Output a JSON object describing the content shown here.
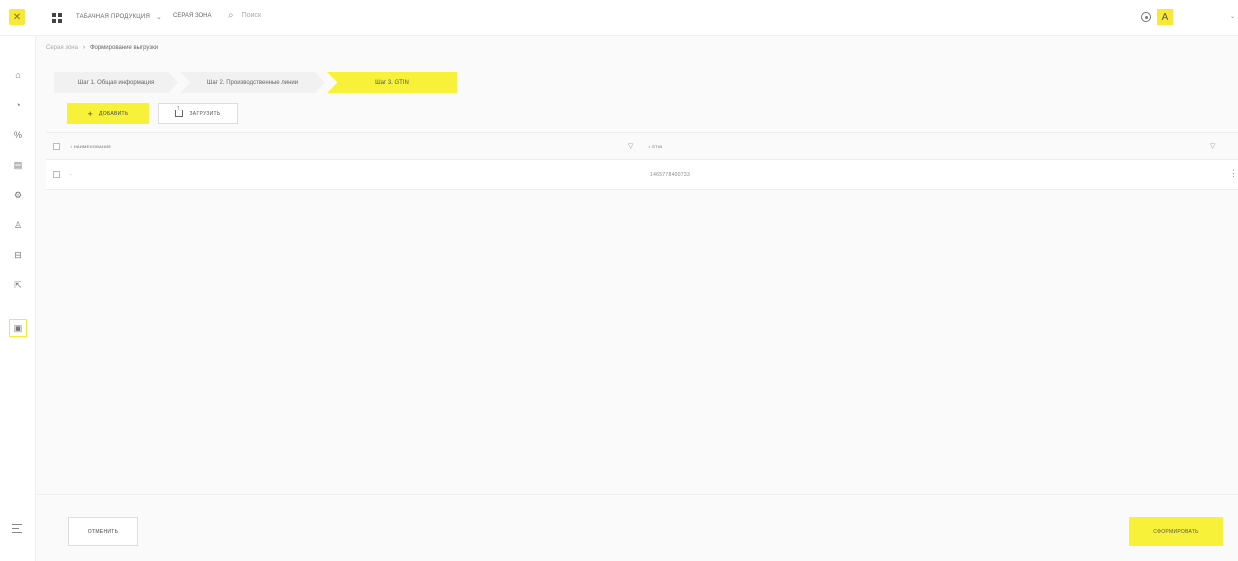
{
  "topbar": {
    "product_label": "ТАБАЧНАЯ ПРОДУКЦИЯ",
    "zone_label": "СЕРАЯ ЗОНА",
    "search_placeholder": "Поиск",
    "avatar_letter": "A"
  },
  "sidebar": {
    "items": [
      {
        "icon": "home-icon"
      },
      {
        "icon": "dashboard-icon"
      },
      {
        "icon": "percent-icon"
      },
      {
        "icon": "document-icon"
      },
      {
        "icon": "settings-icon"
      },
      {
        "icon": "users-icon"
      },
      {
        "icon": "archive-icon"
      },
      {
        "icon": "export-icon"
      },
      {
        "icon": "gray-zone-icon",
        "active": true
      }
    ]
  },
  "breadcrumb": {
    "parent": "Серая зона",
    "current": "Формирование выгрузки"
  },
  "steps": [
    {
      "label": "Шаг 1. Общая информация",
      "active": false
    },
    {
      "label": "Шаг 2. Производственные линии",
      "active": false
    },
    {
      "label": "Шаг 3. GTIN",
      "active": true
    }
  ],
  "actions": {
    "add_label": "ДОБАВИТЬ",
    "upload_label": "ЗАГРУЗИТЬ"
  },
  "table": {
    "columns": [
      "НАИМЕНОВАНИЕ",
      "GTIN"
    ],
    "rows": [
      {
        "name": "-",
        "gtin": "1465778400733"
      }
    ]
  },
  "footer": {
    "cancel_label": "ОТМЕНИТЬ",
    "submit_label": "СФОРМИРОВАТЬ"
  },
  "colors": {
    "accent": "#f7f13a",
    "background": "#fafafa",
    "border": "#eeeeee"
  }
}
